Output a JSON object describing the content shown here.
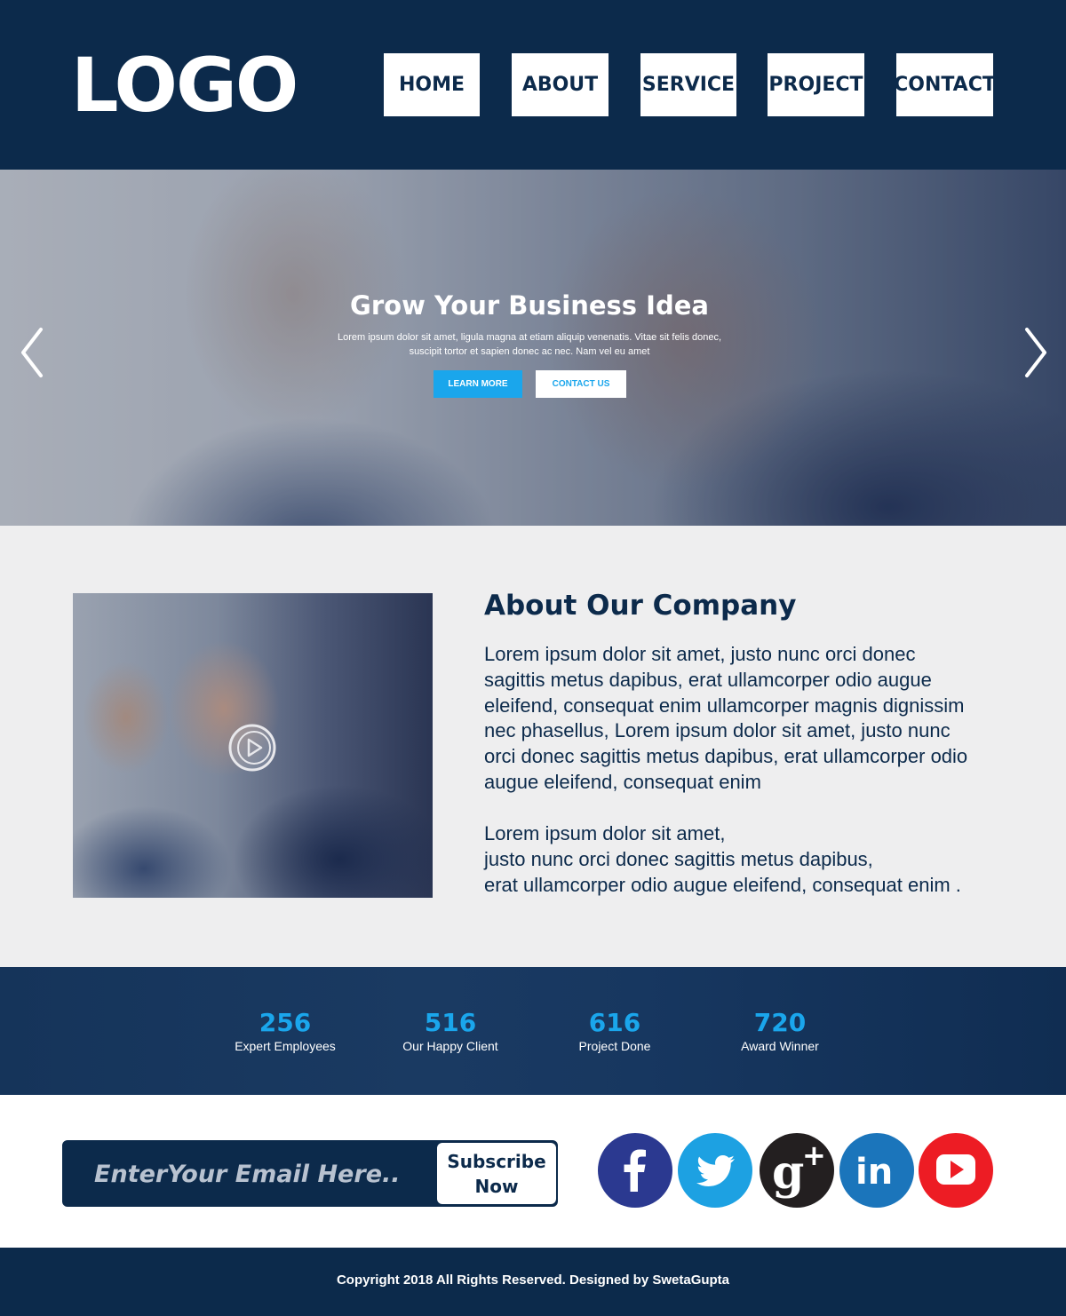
{
  "header": {
    "logo": "LOGO",
    "nav": [
      "HOME",
      "ABOUT",
      "SERVICE",
      "PROJECT",
      "CONTACT"
    ]
  },
  "hero": {
    "title": "Grow Your Business Idea",
    "text_line1": "Lorem ipsum dolor sit amet, ligula magna at etiam aliquip venenatis. Vitae sit felis donec,",
    "text_line2": "suscipit tortor et sapien donec ac nec. Nam vel eu amet",
    "learn_more": "LEARN MORE",
    "contact_us": "CONTACT US"
  },
  "about": {
    "title": "About Our Company",
    "paragraph1": "Lorem ipsum dolor sit amet, justo nunc orci donec sagittis metus dapibus, erat ullamcorper odio augue eleifend, consequat enim ullamcorper magnis dignissim nec phasellus, Lorem ipsum dolor sit amet, justo nunc orci donec sagittis metus dapibus, erat ullamcorper odio augue eleifend, consequat enim",
    "paragraph2_lines": [
      "Lorem ipsum dolor sit amet,",
      "justo nunc orci donec sagittis metus dapibus,",
      "erat ullamcorper odio augue eleifend, consequat enim ."
    ]
  },
  "stats": [
    {
      "number": "256",
      "label": "Expert Employees"
    },
    {
      "number": "516",
      "label": "Our Happy Client"
    },
    {
      "number": "616",
      "label": "Project Done"
    },
    {
      "number": "720",
      "label": "Award Winner"
    }
  ],
  "subscribe": {
    "placeholder": "EnterYour Email Here..",
    "button_line1": "Subscribe",
    "button_line2": "Now"
  },
  "social": [
    {
      "icon": "facebook-icon",
      "color": "#2b3990"
    },
    {
      "icon": "twitter-icon",
      "color": "#1da1e2"
    },
    {
      "icon": "google-plus-icon",
      "color": "#231f20"
    },
    {
      "icon": "linkedin-icon",
      "color": "#1b75bb"
    },
    {
      "icon": "youtube-icon",
      "color": "#ed1c24"
    }
  ],
  "footer": {
    "copyright": "Copyright 2018 All Rights Reserved. Designed by SwetaGupta"
  },
  "colors": {
    "navy": "#0c2a4b",
    "accent": "#1aa6ec",
    "section_bg": "#eeeeef"
  }
}
